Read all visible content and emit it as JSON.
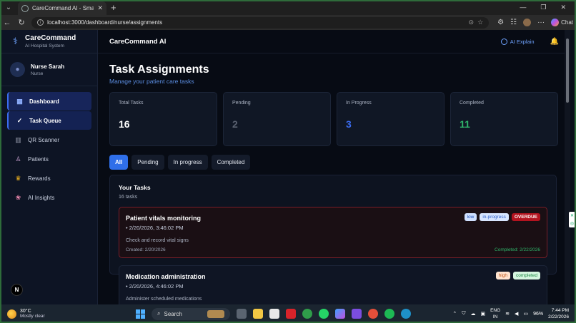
{
  "browser": {
    "tab_title": "CareCommand AI - Smart Digital H",
    "url": "localhost:3000/dashboard/nurse/assignments",
    "chat_label": "Chat"
  },
  "sidebar": {
    "brand_name": "CareCommand",
    "brand_sub": "AI Hospital System",
    "user_name": "Nurse Sarah",
    "user_role": "Nurse",
    "items": [
      {
        "label": "Dashboard",
        "icon": "dashboard-icon",
        "state": "active"
      },
      {
        "label": "Task Queue",
        "icon": "check-icon",
        "state": "hover"
      },
      {
        "label": "QR Scanner",
        "icon": "qr-icon",
        "state": ""
      },
      {
        "label": "Patients",
        "icon": "patients-icon",
        "state": ""
      },
      {
        "label": "Rewards",
        "icon": "trophy-icon",
        "state": ""
      },
      {
        "label": "AI Insights",
        "icon": "brain-icon",
        "state": ""
      }
    ],
    "badge": "N"
  },
  "topbar": {
    "title": "CareCommand AI",
    "ai_explain": "AI Explain"
  },
  "page": {
    "title": "Task Assignments",
    "subtitle": "Manage your patient care tasks"
  },
  "stats": [
    {
      "label": "Total Tasks",
      "value": "16",
      "color": "#ffffff"
    },
    {
      "label": "Pending",
      "value": "2",
      "color": "#5a6170"
    },
    {
      "label": "In Progress",
      "value": "3",
      "color": "#3b6cf0"
    },
    {
      "label": "Completed",
      "value": "11",
      "color": "#2fb56a"
    }
  ],
  "filters": [
    {
      "label": "All",
      "active": true
    },
    {
      "label": "Pending",
      "active": false
    },
    {
      "label": "In progress",
      "active": false
    },
    {
      "label": "Completed",
      "active": false
    }
  ],
  "tasks_panel": {
    "title": "Your Tasks",
    "count": "16 tasks",
    "tasks": [
      {
        "title": "Patient vitals monitoring",
        "datetime": "• 2/20/2026, 3:46:02 PM",
        "description": "Check and record vital signs",
        "created": "Created: 2/20/2026",
        "completed": "Completed: 2/22/2026",
        "badges": [
          "low",
          "in-progress",
          "OVERDUE"
        ]
      },
      {
        "title": "Medication administration",
        "datetime": "• 2/20/2026, 4:46:02 PM",
        "description": "Administer scheduled medications",
        "badges": [
          "high",
          "completed"
        ]
      }
    ]
  },
  "taskbar": {
    "temp": "30°C",
    "condition": "Mostly clear",
    "search": "Search",
    "lang_top": "ENG",
    "lang_bottom": "IN",
    "battery": "96%",
    "time": "7:44 PM",
    "date": "2/22/2026"
  }
}
